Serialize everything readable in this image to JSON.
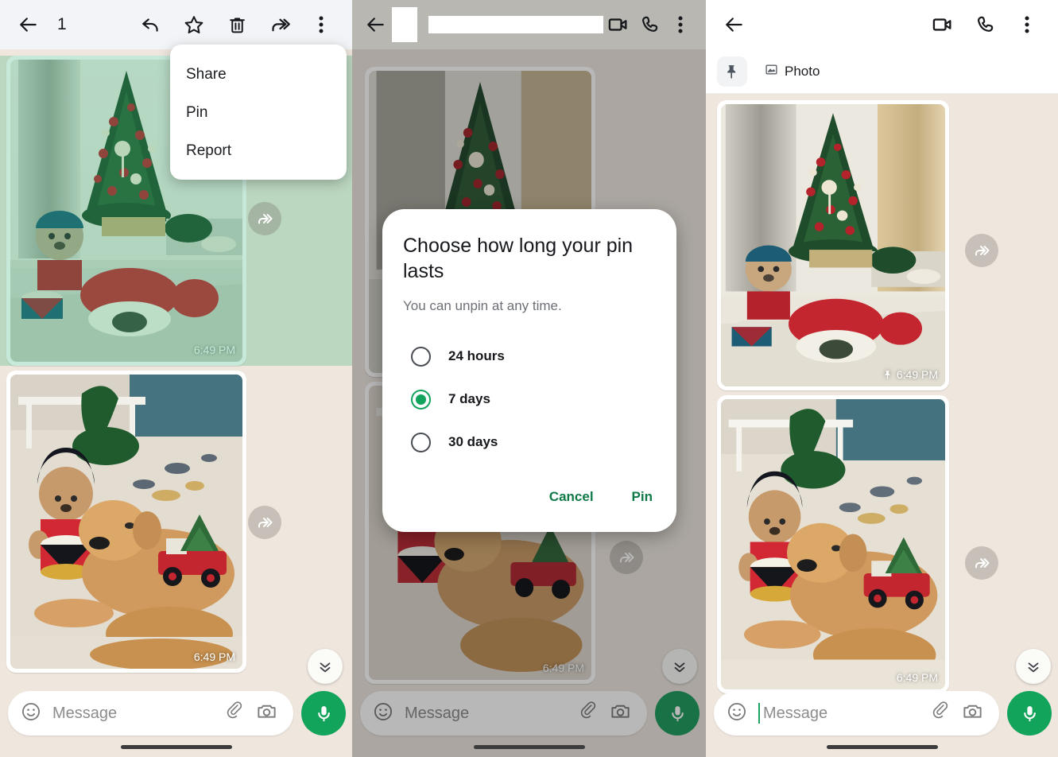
{
  "panels": [
    {
      "id": "selection-mode",
      "topbar": {
        "back_icon": "arrow-back-icon",
        "selected_count": "1",
        "actions": [
          "reply-icon",
          "star-icon",
          "delete-icon",
          "forward-icon",
          "overflow-menu-icon"
        ]
      },
      "menu": {
        "items": [
          {
            "label": "Share"
          },
          {
            "label": "Pin"
          },
          {
            "label": "Report"
          }
        ]
      },
      "messages": [
        {
          "type": "photo",
          "timestamp": "6:49 PM",
          "selected": true,
          "pinned": false,
          "forwardable": true
        },
        {
          "type": "photo",
          "timestamp": "6:49 PM",
          "selected": false,
          "pinned": false,
          "forwardable": true
        }
      ],
      "composer": {
        "placeholder": "Message",
        "caret": false,
        "icons": [
          "emoji-icon",
          "attach-icon",
          "camera-icon",
          "mic-icon"
        ]
      }
    },
    {
      "id": "pin-duration-dialog",
      "topbar": {
        "back_icon": "arrow-back-icon",
        "contact_name_redacted": true,
        "actions": [
          "video-call-icon",
          "voice-call-icon",
          "overflow-menu-icon"
        ]
      },
      "dialog": {
        "title": "Choose how long your pin lasts",
        "subtitle": "You can unpin at any time.",
        "options": [
          {
            "label": "24 hours",
            "selected": false
          },
          {
            "label": "7 days",
            "selected": true
          },
          {
            "label": "30 days",
            "selected": false
          }
        ],
        "cancel_label": "Cancel",
        "confirm_label": "Pin"
      },
      "messages": [
        {
          "type": "photo",
          "timestamp": "",
          "selected": false,
          "pinned": false,
          "forwardable": true
        },
        {
          "type": "photo",
          "timestamp": "6:49 PM",
          "selected": false,
          "pinned": false,
          "forwardable": true
        }
      ],
      "composer": {
        "placeholder": "Message",
        "caret": false,
        "icons": [
          "emoji-icon",
          "attach-icon",
          "camera-icon",
          "mic-icon"
        ]
      }
    },
    {
      "id": "pinned-result",
      "topbar": {
        "back_icon": "arrow-back-icon",
        "actions": [
          "video-call-icon",
          "voice-call-icon",
          "overflow-menu-icon"
        ]
      },
      "pinned_bar": {
        "icon": "pin-icon",
        "attachment_icon": "photo-icon",
        "label": "Photo"
      },
      "messages": [
        {
          "type": "photo",
          "timestamp": "6:49 PM",
          "selected": false,
          "pinned": true,
          "forwardable": true
        },
        {
          "type": "photo",
          "timestamp": "6:49 PM",
          "selected": false,
          "pinned": false,
          "forwardable": true
        }
      ],
      "composer": {
        "placeholder": "Message",
        "caret": true,
        "icons": [
          "emoji-icon",
          "attach-icon",
          "camera-icon",
          "mic-icon"
        ]
      }
    }
  ],
  "colors": {
    "accent_green": "#12A45C",
    "chat_background": "#EFE7DE",
    "selection_overlay": "#28AA6E",
    "selection_toolbar": "#F2F4F7",
    "dialog_surface": "#FFFFFF",
    "action_text": "#0F7A47"
  }
}
